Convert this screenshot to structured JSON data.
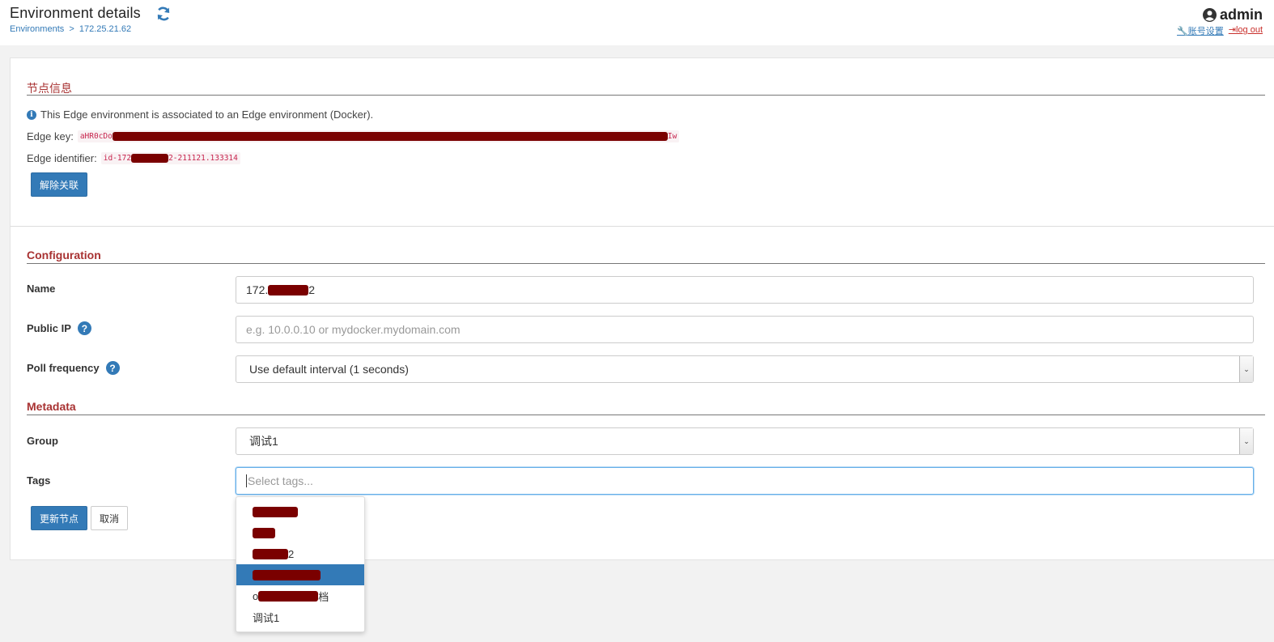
{
  "header": {
    "title": "Environment details",
    "breadcrumb_root": "Environments",
    "breadcrumb_sep": ">",
    "breadcrumb_current": "172.25.21.62",
    "user": "admin",
    "account_settings": "账号设置",
    "logout": "log out"
  },
  "node_info": {
    "section_title": "节点信息",
    "info_text": "This Edge environment is associated to an Edge environment (Docker).",
    "edge_key_label": "Edge key:",
    "edge_key_prefix": "aHR0cDo",
    "edge_key_suffix": "Iw",
    "edge_id_label": "Edge identifier:",
    "edge_id_prefix": "id-172",
    "edge_id_suffix": "2-211121.133314",
    "disassociate_button": "解除关联"
  },
  "configuration": {
    "section_title": "Configuration",
    "name_label": "Name",
    "name_value_prefix": "172.",
    "name_value_suffix": "2",
    "public_ip_label": "Public IP",
    "public_ip_placeholder": "e.g. 10.0.0.10 or mydocker.mydomain.com",
    "poll_label": "Poll frequency",
    "poll_value": "Use default interval (1 seconds)"
  },
  "metadata": {
    "section_title": "Metadata",
    "group_label": "Group",
    "group_value": "调试1",
    "tags_label": "Tags",
    "tags_placeholder": "Select tags...",
    "update_button": "更新节点",
    "cancel_button": "取消"
  },
  "tags_dropdown": {
    "items": [
      {
        "prefix": "",
        "suffix": ""
      },
      {
        "prefix": "",
        "suffix": ""
      },
      {
        "prefix": "",
        "suffix": "2"
      },
      {
        "prefix": "",
        "suffix": "",
        "active": true
      },
      {
        "prefix": "o",
        "suffix": "档"
      },
      {
        "prefix": "调试1",
        "suffix": ""
      }
    ]
  },
  "colors": {
    "accent": "#337ab7",
    "section_title": "#a83232",
    "redaction": "#7a0000"
  }
}
